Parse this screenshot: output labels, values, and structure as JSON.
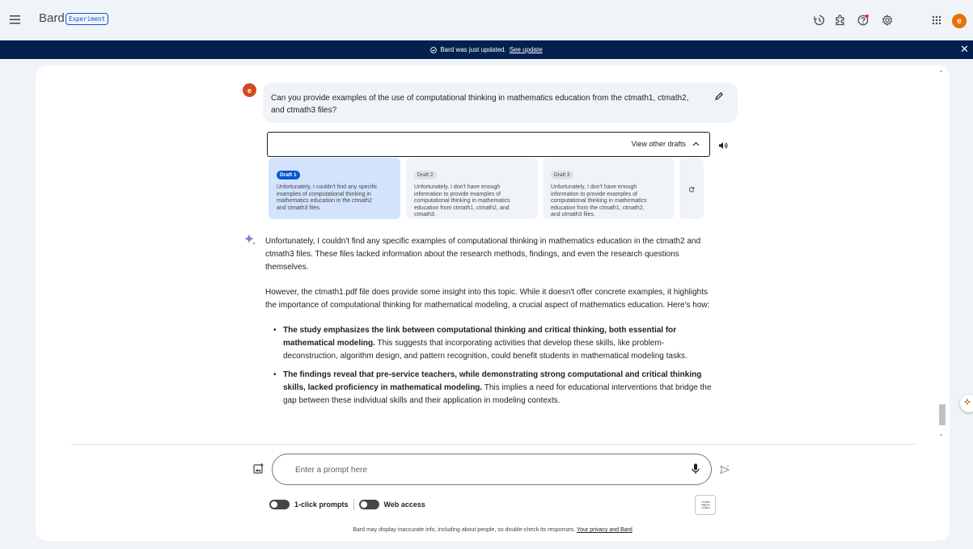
{
  "header": {
    "brand": "Bard",
    "badge": "Experiment",
    "avatar_letter": "e",
    "icons": [
      "menu-icon",
      "history-icon",
      "extensions-icon",
      "help-icon",
      "settings-icon",
      "apps-grid-icon"
    ]
  },
  "banner": {
    "message": "Bard was just updated.",
    "link": "See update",
    "close": "✕"
  },
  "conversation": {
    "user_avatar_letter": "e",
    "user_prompt": "Can you provide examples of the use of computational thinking in mathematics education from the ctmath1, ctmath2, and ctmath3 files?",
    "drafts_toggle_label": "View other drafts",
    "drafts": [
      {
        "label": "Draft 1",
        "text": "Unfortunately, I couldn't find any specific examples of computational thinking in mathematics education in the ctmath2 and ctmath3 files.",
        "active": true
      },
      {
        "label": "Draft 2",
        "text": "Unfortunately, I don't have enough information to provide examples of computational thinking in mathematics education from ctmath1, ctmath2, and ctmath3.",
        "active": false
      },
      {
        "label": "Draft 3",
        "text": "Unfortunately, I don't have enough information to provide examples of computational thinking in mathematics education from the ctmath1, ctmath2, and ctmath3 files.",
        "active": false
      }
    ],
    "response": {
      "p1": "Unfortunately, I couldn't find any specific examples of computational thinking in mathematics education in the ctmath2 and ctmath3 files. These files lacked information about the research methods, findings, and even the research questions themselves.",
      "p2": "However, the ctmath1.pdf file does provide some insight into this topic. While it doesn't offer concrete examples, it highlights the importance of computational thinking for mathematical modeling, a crucial aspect of mathematics education. Here's how:",
      "bullets": [
        {
          "bold": "The study emphasizes the link between computational thinking and critical thinking, both essential for mathematical modeling.",
          "rest": " This suggests that incorporating activities that develop these skills, like problem-deconstruction, algorithm design, and pattern recognition, could benefit students in mathematical modeling tasks."
        },
        {
          "bold": "The findings reveal that pre-service teachers, while demonstrating strong computational and critical thinking skills, lacked proficiency in mathematical modeling.",
          "rest": " This implies a need for educational interventions that bridge the gap between these individual skills and their application in modeling contexts."
        }
      ]
    }
  },
  "composer": {
    "placeholder": "Enter a prompt here",
    "toggle_1": "1-click prompts",
    "toggle_2": "Web access"
  },
  "footer": {
    "disclaimer": "Bard may display inaccurate info, including about people, so double-check its responses.",
    "privacy_link": "Your privacy and Bard"
  },
  "colors": {
    "background": "#f0f4f9",
    "banner": "#04204f",
    "accent": "#0b57d0",
    "avatar": "#e8710a"
  }
}
